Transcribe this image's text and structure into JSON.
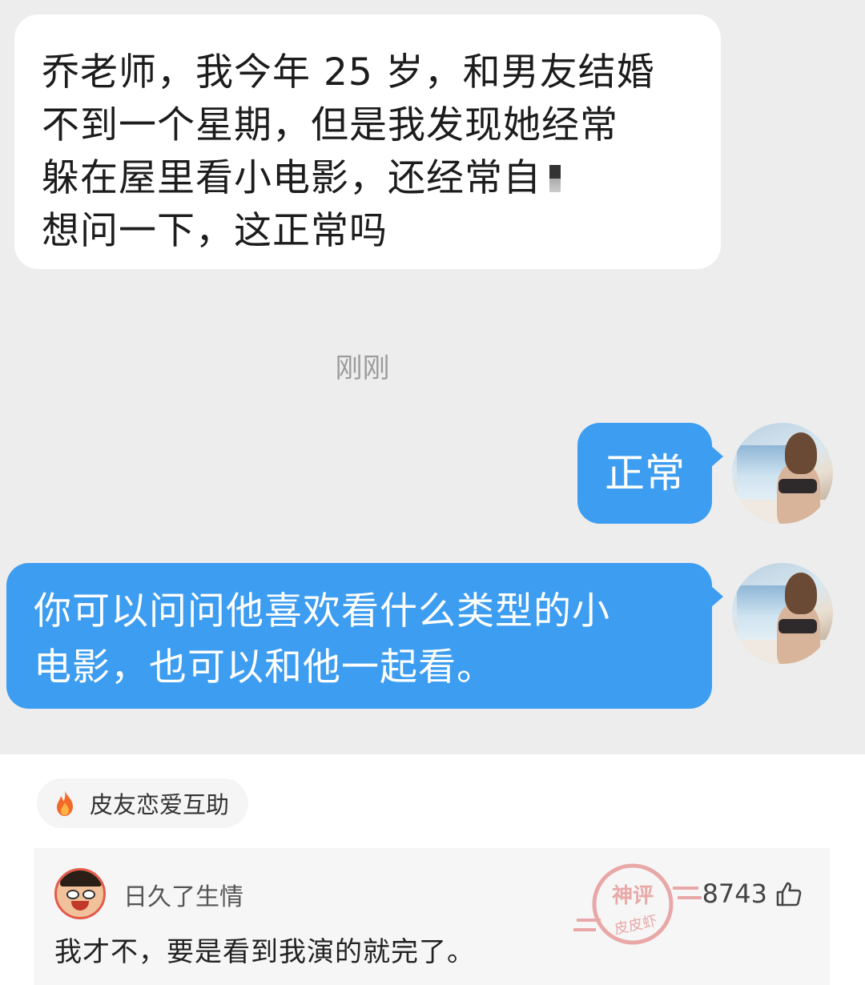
{
  "chat": {
    "incoming_message": {
      "lines": [
        "乔老师，我今年 25 岁，和男友结婚",
        "不到一个星期，但是我发现她经常",
        "躲在屋里看小电影，还经常自",
        "想问一下，这正常吗"
      ]
    },
    "timestamp": "刚刚",
    "reply_1": "正常",
    "reply_2": {
      "lines": [
        "你可以问问他喜欢看什么类型的小",
        "电影，也可以和他一起看。"
      ]
    },
    "avatar_icon": "user-avatar"
  },
  "topic_tag": {
    "icon": "fire-icon",
    "label": "皮友恋爱互助"
  },
  "comment": {
    "username": "日久了生情",
    "text": "我才不，要是看到我演的就完了。",
    "likes": "8743",
    "like_icon": "thumbs-up-icon"
  },
  "watermark": {
    "top_text": "神评",
    "bottom_text": "皮皮虾"
  },
  "colors": {
    "chat_background": "#ededed",
    "outgoing_bubble": "#3d9df0",
    "incoming_bubble": "#ffffff",
    "watermark": "#e06a6a"
  }
}
